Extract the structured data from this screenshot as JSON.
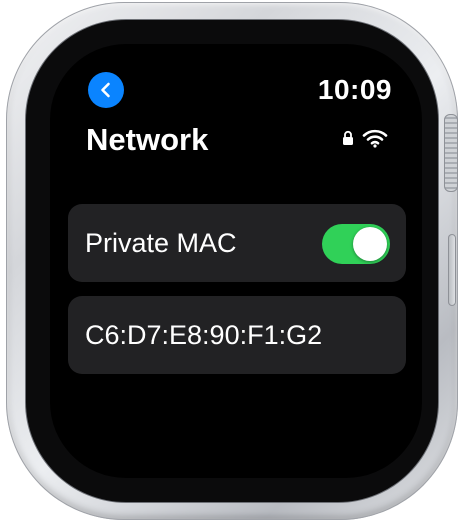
{
  "status_bar": {
    "time": "10:09"
  },
  "header": {
    "back_icon": "chevron-left-icon",
    "title": "Network",
    "lock_icon": "lock-icon",
    "wifi_icon": "wifi-icon"
  },
  "settings": {
    "private_mac": {
      "label": "Private MAC",
      "enabled": true
    },
    "mac_address": "C6:D7:E8:90:F1:G2"
  },
  "colors": {
    "accent_blue": "#0a84ff",
    "toggle_on_green": "#30d158",
    "row_background": "#222224",
    "screen_background": "#000000"
  }
}
